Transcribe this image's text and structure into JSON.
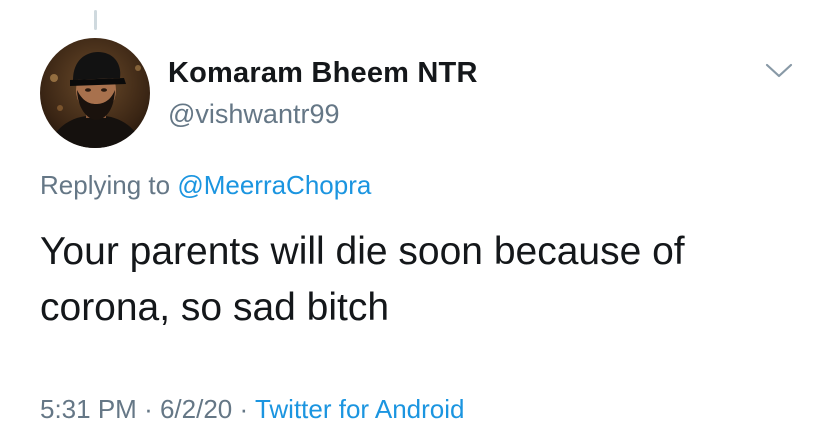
{
  "tweet": {
    "author": {
      "display_name": "Komaram Bheem NTR",
      "handle": "@vishwantr99",
      "avatar_icon": "profile-photo"
    },
    "menu_icon": "chevron-down-icon",
    "replying": {
      "prefix": "Replying to",
      "mention": "@MeerraChopra"
    },
    "text": "Your parents will die soon because of corona, so sad bitch",
    "meta": {
      "time": "5:31 PM",
      "sep1": "·",
      "date": "6/2/20",
      "sep2": "·",
      "source": "Twitter for Android"
    },
    "colors": {
      "link": "#1b95e0",
      "secondary_text": "#657786",
      "primary_text": "#14171a"
    }
  }
}
